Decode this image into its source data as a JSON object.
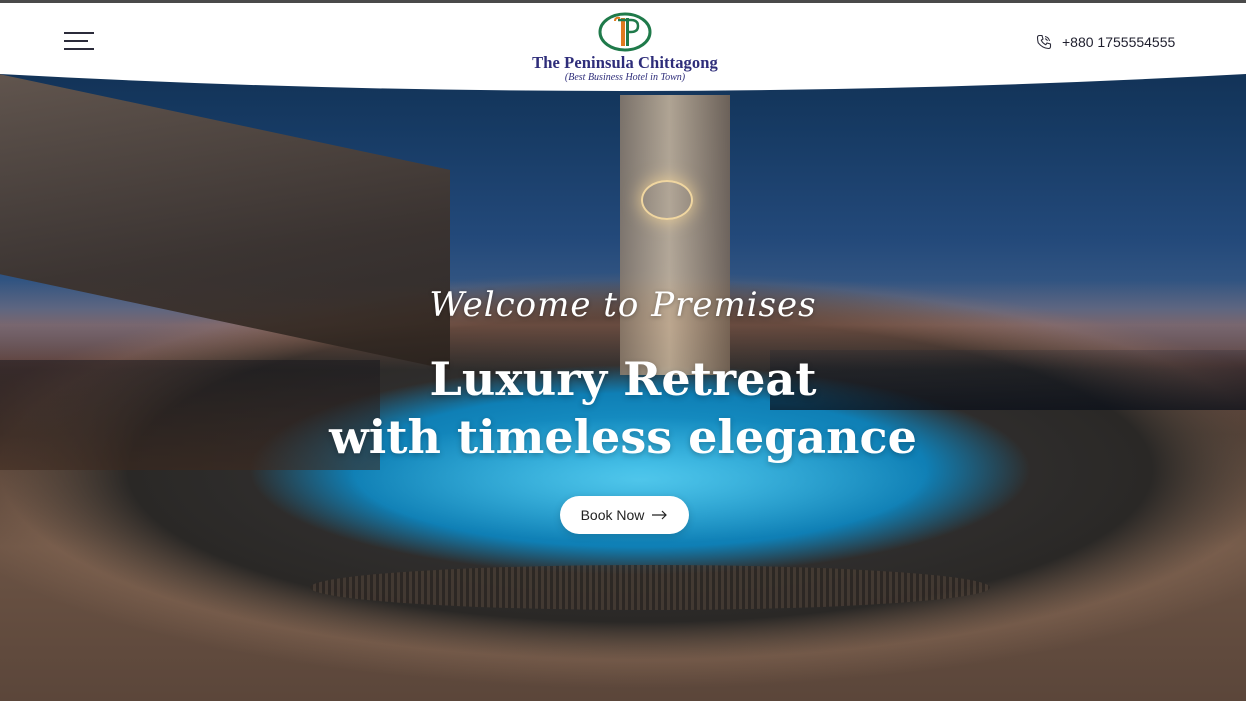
{
  "header": {
    "brand_name": "The Peninsula Chittagong",
    "brand_tagline": "(Best Business Hotel in Town)",
    "phone_number": "+880 1755554555",
    "icons": {
      "menu": "hamburger-menu-icon",
      "phone": "phone-icon",
      "logo": "peninsula-logo-mark"
    }
  },
  "hero": {
    "script_heading": "Welcome to Premises",
    "title_line1": "Luxury Retreat",
    "title_line2": "with timeless elegance",
    "book_button_label": "Book Now",
    "book_button_icon": "arrow-right-icon"
  },
  "colors": {
    "brand_navy": "#2e2d7a",
    "logo_green": "#1f7a4a",
    "logo_orange": "#e07a1f",
    "button_bg": "#ffffff",
    "hero_text": "#ffffff"
  }
}
